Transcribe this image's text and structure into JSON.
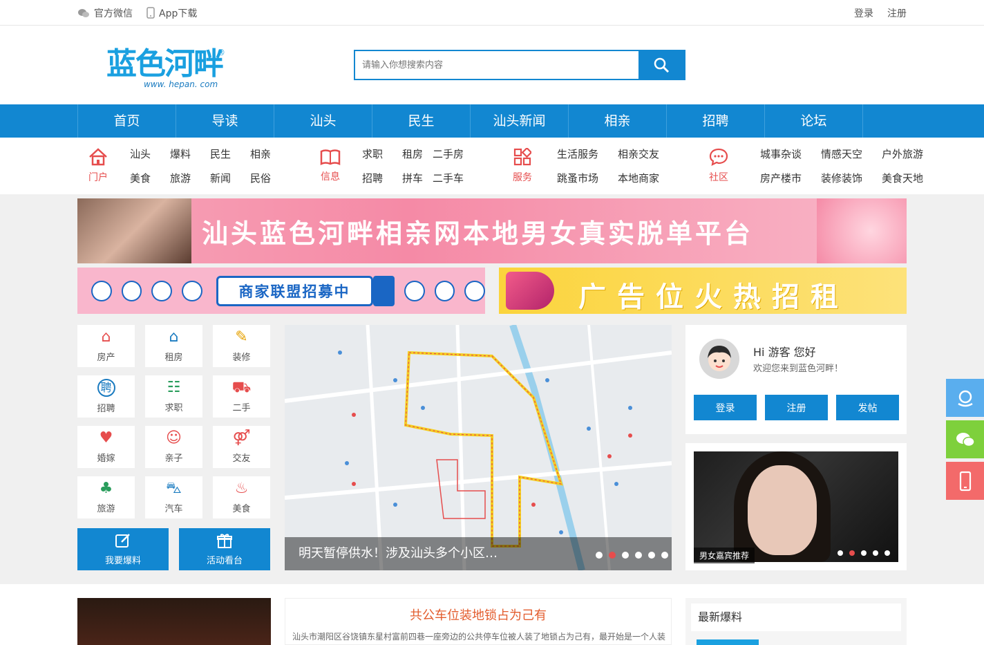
{
  "topbar": {
    "wechat": "官方微信",
    "app": "App下载",
    "login": "登录",
    "register": "注册"
  },
  "header": {
    "logo_text": "蓝色河畔",
    "logo_url": "www. hepan. com",
    "search_placeholder": "请输入你想搜索内容"
  },
  "nav": [
    "首页",
    "导读",
    "汕头",
    "民生",
    "汕头新闻",
    "相亲",
    "招聘",
    "论坛"
  ],
  "subnav": [
    {
      "label": "门户",
      "links": [
        "汕头",
        "爆料",
        "民生",
        "相亲",
        "美食",
        "旅游",
        "新闻",
        "民俗"
      ]
    },
    {
      "label": "信息",
      "links": [
        "求职",
        "租房",
        "二手房",
        "招聘",
        "拼车",
        "二手车"
      ]
    },
    {
      "label": "服务",
      "links": [
        "生活服务",
        "相亲交友",
        "跳蚤市场",
        "本地商家"
      ]
    },
    {
      "label": "社区",
      "links": [
        "城事杂谈",
        "情感天空",
        "户外旅游",
        "房产楼市",
        "装修装饰",
        "美食天地"
      ]
    }
  ],
  "banners": {
    "main": "汕头蓝色河畔相亲网本地男女真实脱单平台",
    "merchant": "商家联盟招募中",
    "ad": "广告位火热招租"
  },
  "icon_grid": [
    {
      "label": "房产",
      "icon": "house-icon",
      "sym": "⌂",
      "color": "#e64d4d"
    },
    {
      "label": "租房",
      "icon": "rent-icon",
      "sym": "⌂",
      "color": "#1a7bc0"
    },
    {
      "label": "装修",
      "icon": "brush-icon",
      "sym": "✎",
      "color": "#e6a100"
    },
    {
      "label": "招聘",
      "icon": "hire-icon",
      "sym": "聘",
      "color": "#1a7bc0"
    },
    {
      "label": "求职",
      "icon": "resume-icon",
      "sym": "☷",
      "color": "#2a9d5c"
    },
    {
      "label": "二手",
      "icon": "cart-icon",
      "sym": "⛟",
      "color": "#e64d4d"
    },
    {
      "label": "婚嫁",
      "icon": "couple-icon",
      "sym": "♥",
      "color": "#e64d4d"
    },
    {
      "label": "亲子",
      "icon": "family-icon",
      "sym": "☺",
      "color": "#e64d4d"
    },
    {
      "label": "交友",
      "icon": "gender-icon",
      "sym": "⚤",
      "color": "#e64d4d"
    },
    {
      "label": "旅游",
      "icon": "palm-icon",
      "sym": "♣",
      "color": "#2a9d5c"
    },
    {
      "label": "汽车",
      "icon": "car-icon",
      "sym": "⛍",
      "color": "#1a7bc0"
    },
    {
      "label": "美食",
      "icon": "food-icon",
      "sym": "♨",
      "color": "#e64d4d"
    }
  ],
  "big_buttons": [
    "我要爆料",
    "活动看台"
  ],
  "slider": {
    "caption": "明天暂停供水！涉及汕头多个小区…",
    "dots": 6,
    "active": 1
  },
  "user": {
    "greeting": "Hi 游客 您好",
    "welcome": "欢迎您来到蓝色河畔！",
    "login": "登录",
    "register": "注册",
    "post": "发帖"
  },
  "photo": {
    "label": "男女嘉宾推荐",
    "dots": 5,
    "active": 1
  },
  "news": {
    "title": "共公车位装地锁占为己有",
    "desc": "汕头市潮阳区谷饶镇东星村富前四巷一座旁边的公共停车位被人装了地锁占为己有，最开始是一个人装"
  },
  "latest": {
    "title": "最新爆料"
  },
  "colors": {
    "primary": "#1287d1",
    "accent": "#e64d4d"
  }
}
